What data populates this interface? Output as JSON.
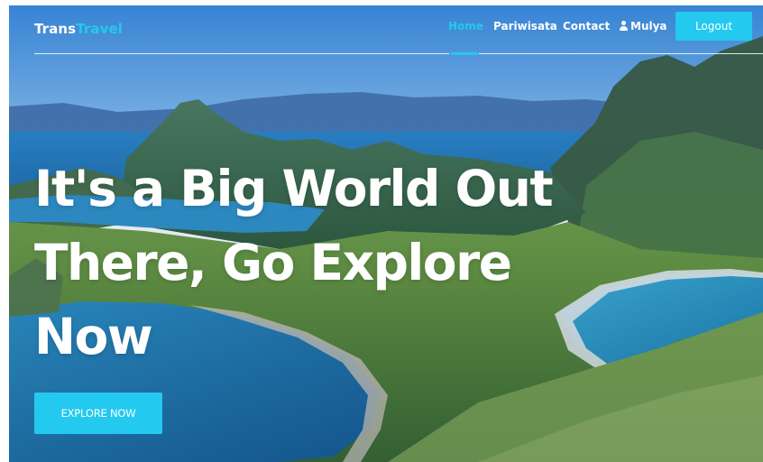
{
  "navbar": {
    "brand_part1": "Trans",
    "brand_part2": "Travel",
    "links": [
      {
        "label": "Home",
        "active": true
      },
      {
        "label": "Pariwisata",
        "active": false
      },
      {
        "label": "Contact",
        "active": false
      }
    ],
    "user": {
      "name": "Mulya",
      "icon": "user-icon"
    },
    "logout_label": "Logout"
  },
  "hero": {
    "headline_line1": "It's a Big World Out",
    "headline_line2": "There, Go Explore",
    "headline_line3": "Now",
    "cta_label": "EXPLORE NOW",
    "background": "landscape-photo-islands-and-bays"
  },
  "colors": {
    "accent": "#23c9ef",
    "text": "#ffffff"
  }
}
